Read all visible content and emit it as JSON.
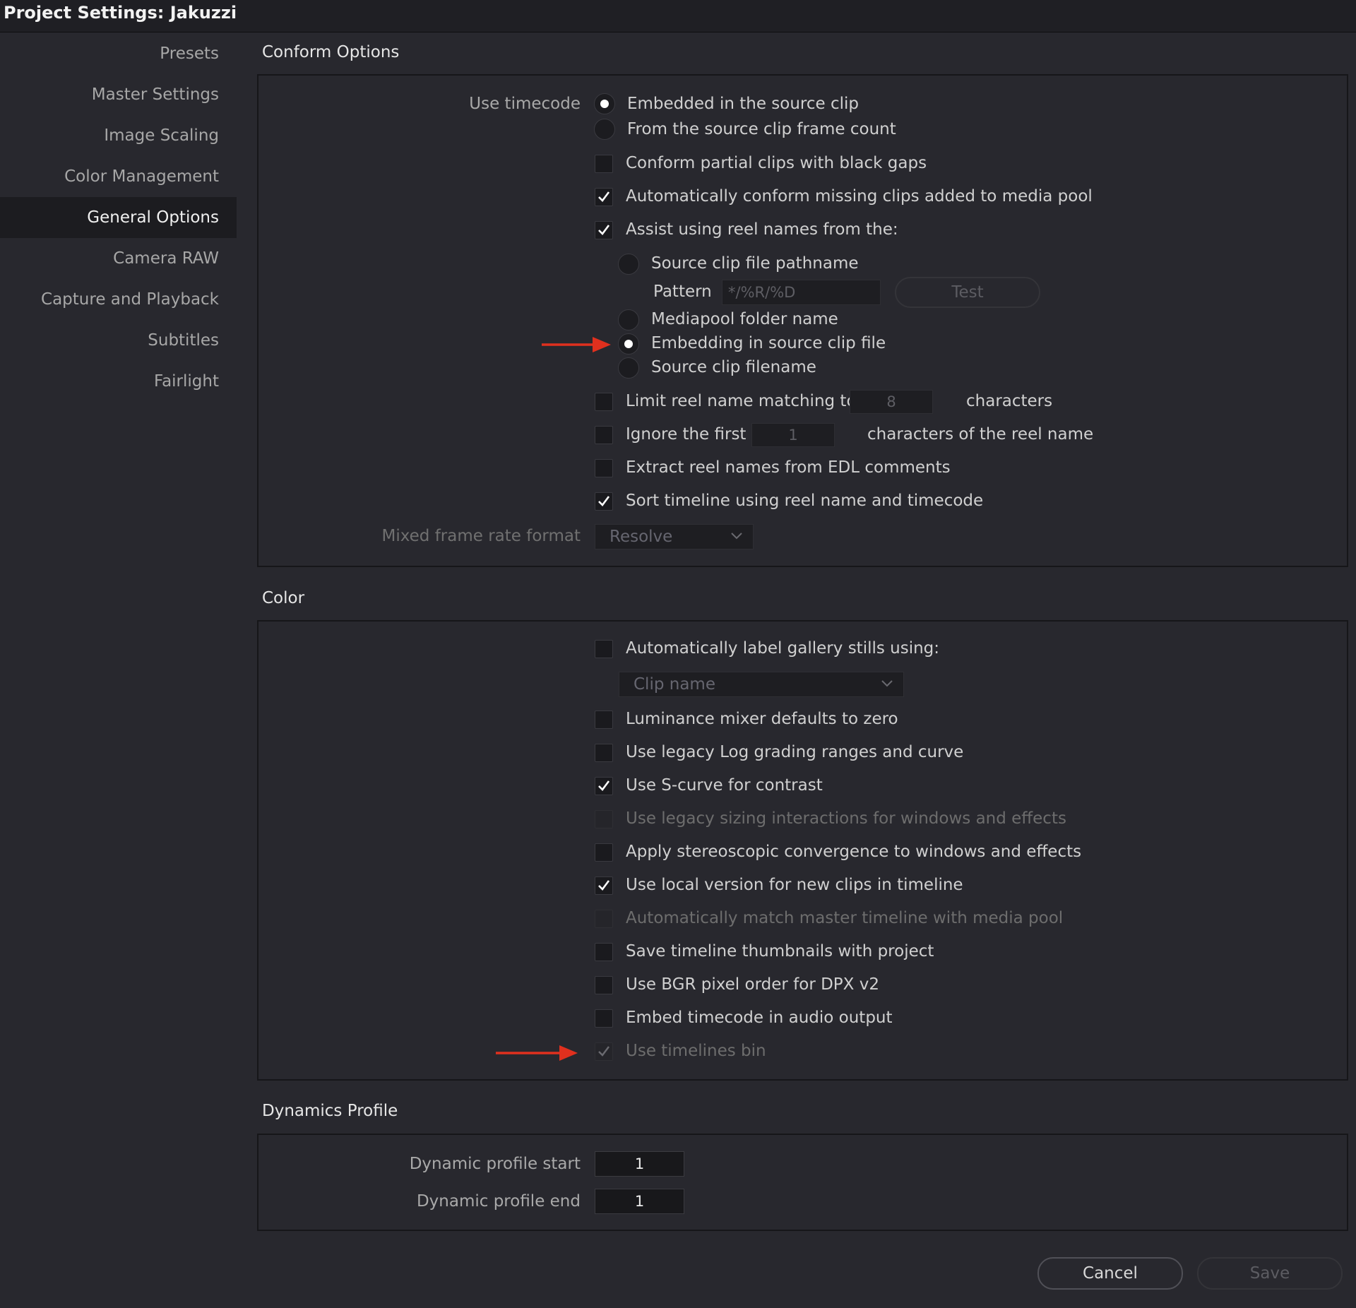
{
  "window": {
    "title": "Project Settings:  Jakuzzi"
  },
  "sidebar": {
    "items": [
      {
        "label": "Presets",
        "active": false
      },
      {
        "label": "Master Settings",
        "active": false
      },
      {
        "label": "Image Scaling",
        "active": false
      },
      {
        "label": "Color Management",
        "active": false
      },
      {
        "label": "General Options",
        "active": true
      },
      {
        "label": "Camera RAW",
        "active": false
      },
      {
        "label": "Capture and Playback",
        "active": false
      },
      {
        "label": "Subtitles",
        "active": false
      },
      {
        "label": "Fairlight",
        "active": false
      }
    ]
  },
  "conform": {
    "section_title": "Conform Options",
    "use_timecode_label": "Use timecode",
    "timecode_embedded": "Embedded in the source clip",
    "timecode_framecount": "From the source clip frame count",
    "partial_clips": "Conform partial clips with black gaps",
    "auto_conform": "Automatically conform missing clips added to media pool",
    "assist_reel": "Assist using reel names from the:",
    "reel_pathname": "Source clip file pathname",
    "pattern_label": "Pattern",
    "pattern_placeholder": "*/%R/%D",
    "test_button": "Test",
    "reel_mediapool": "Mediapool folder name",
    "reel_embedding": "Embedding in source clip file",
    "reel_filename": "Source clip filename",
    "limit_reel": "Limit reel name matching to",
    "limit_value": "8",
    "limit_suffix": "characters",
    "ignore_first": "Ignore the first",
    "ignore_value": "1",
    "ignore_suffix": "characters of the reel name",
    "extract_edl": "Extract reel names from EDL comments",
    "sort_timeline": "Sort timeline using reel name and timecode",
    "mixed_frame_label": "Mixed frame rate format",
    "mixed_frame_value": "Resolve"
  },
  "color": {
    "section_title": "Color",
    "auto_label_stills": "Automatically label gallery stills using:",
    "stills_dropdown_value": "Clip name",
    "luminance_mixer": "Luminance mixer defaults to zero",
    "legacy_log": "Use legacy Log grading ranges and curve",
    "s_curve": "Use S-curve for contrast",
    "legacy_sizing": "Use legacy sizing interactions for windows and effects",
    "stereo_convergence": "Apply stereoscopic convergence to windows and effects",
    "local_version": "Use local version for new clips in timeline",
    "auto_match_master": "Automatically match master timeline with media pool",
    "save_thumbnails": "Save timeline thumbnails with project",
    "bgr_pixel": "Use BGR pixel order for DPX v2",
    "embed_timecode_audio": "Embed timecode in audio output",
    "timelines_bin": "Use timelines bin"
  },
  "dynamics": {
    "section_title": "Dynamics Profile",
    "start_label": "Dynamic profile start",
    "start_value": "1",
    "end_label": "Dynamic profile end",
    "end_value": "1"
  },
  "footer": {
    "cancel": "Cancel",
    "save": "Save"
  },
  "colors": {
    "accent_arrow": "#e0301e",
    "background": "#28282e",
    "sidebar_active": "#1c1c20"
  }
}
